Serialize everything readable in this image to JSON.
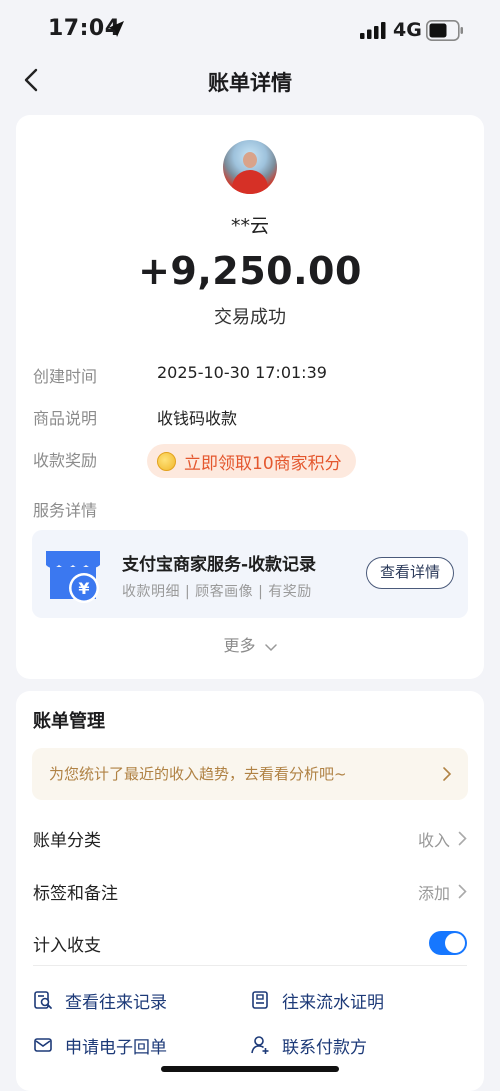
{
  "status_bar": {
    "time": "17:04",
    "network": "4G",
    "icons": [
      "location-arrow-icon",
      "signal-bars-icon",
      "battery-icon"
    ]
  },
  "nav": {
    "title": "账单详情",
    "back_icon": "chevron-left-icon"
  },
  "transaction": {
    "payer": "**云",
    "amount": "+9,250.00",
    "status": "交易成功",
    "rows": [
      {
        "label": "创建时间",
        "value": "2025-10-30 17:01:39"
      },
      {
        "label": "商品说明",
        "value": "收钱码收款"
      }
    ],
    "reward_label": "收款奖励",
    "reward_text": "立即领取10商家积分",
    "service_label": "服务详情",
    "service": {
      "title": "支付宝商家服务-收款记录",
      "tags": "收款明细 | 顾客画像 | 有奖励",
      "button": "查看详情",
      "icon": "store-yuan-icon"
    },
    "more": "更多"
  },
  "manage": {
    "title": "账单管理",
    "tip": "为您统计了最近的收入趋势，去看看分析吧~",
    "category_label": "账单分类",
    "category_value": "收入",
    "tags_label": "标签和备注",
    "tags_value": "添加",
    "count_label": "计入收支",
    "count_enabled": true,
    "links": [
      {
        "label": "查看往来记录",
        "icon": "record-search-icon"
      },
      {
        "label": "往来流水证明",
        "icon": "document-icon"
      },
      {
        "label": "申请电子回单",
        "icon": "mail-icon"
      },
      {
        "label": "联系付款方",
        "icon": "contact-add-icon"
      }
    ]
  },
  "colors": {
    "accent_blue": "#1677ff",
    "reward_orange": "#e4572e",
    "tip_brown": "#b08244",
    "link_navy": "#1d3a78"
  }
}
